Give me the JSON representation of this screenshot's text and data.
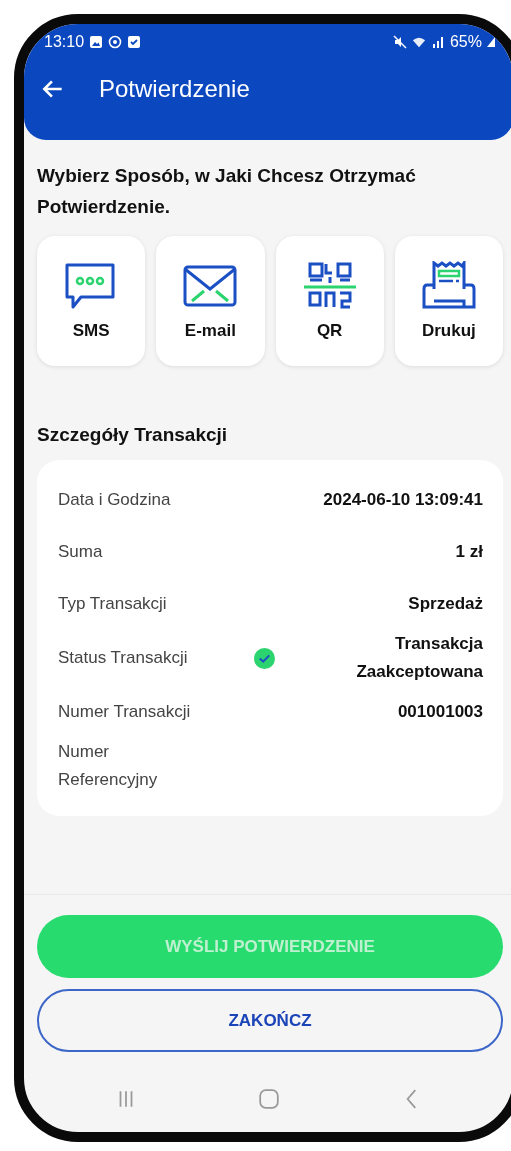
{
  "status_bar": {
    "time": "13:10",
    "battery": "65%"
  },
  "app_bar": {
    "title": "Potwierdzenie"
  },
  "prompt": "Wybierz Sposób, w Jaki Chcesz Otrzymać Potwierdzenie.",
  "options": [
    {
      "kind": "sms",
      "label": "SMS"
    },
    {
      "kind": "email",
      "label": "E-mail"
    },
    {
      "kind": "qr",
      "label": "QR"
    },
    {
      "kind": "print",
      "label": "Drukuj"
    }
  ],
  "details": {
    "title": "Szczegóły Transakcji",
    "rows": [
      {
        "kind": "plain",
        "label": "Data i Godzina",
        "value": "2024-06-10 13:09:41"
      },
      {
        "kind": "plain",
        "label": "Suma",
        "value": "1 zł"
      },
      {
        "kind": "plain",
        "label": "Typ Transakcji",
        "value": "Sprzedaż"
      },
      {
        "kind": "status",
        "label": "Status Transakcji",
        "value": "Transakcja Zaakceptowana"
      },
      {
        "kind": "plain",
        "label": "Numer Transakcji",
        "value": "001001003"
      },
      {
        "kind": "plain",
        "label": "Numer Referencyjny",
        "value": ""
      }
    ]
  },
  "buttons": [
    {
      "kind": "primary",
      "label": "WYŚLIJ POTWIERDZENIE",
      "disabled": true
    },
    {
      "kind": "outline",
      "label": "ZAKOŃCZ",
      "disabled": false
    }
  ]
}
